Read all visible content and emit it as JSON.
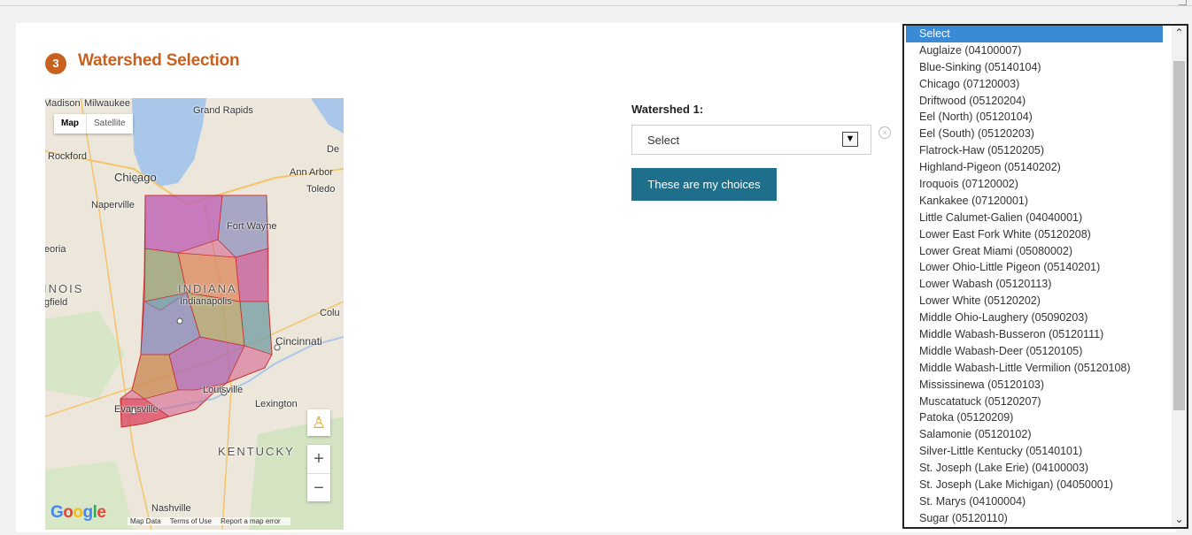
{
  "heading": {
    "step": "3",
    "title": "Watershed Selection"
  },
  "map": {
    "type_control": {
      "map": "Map",
      "satellite": "Satellite"
    },
    "labels": {
      "madison": "Madison",
      "milwaukee": "Milwaukee",
      "grand_rapids": "Grand Rapids",
      "rockford": "Rockford",
      "chicago": "Chicago",
      "ann_arbor": "Ann Arbor",
      "toledo": "Toledo",
      "naperville": "Naperville",
      "fort_wayne": "Fort Wayne",
      "peoria": "eoria",
      "illinois": "INOIS",
      "springfield": "gfield",
      "indiana": "INDIANA",
      "indianapolis": "Indianapolis",
      "columbus": "Colu",
      "cincinnati": "Cincinnati",
      "louisville": "Louisville",
      "evansville": "Evansville",
      "lexington": "Lexington",
      "kentucky": "KENTUCKY",
      "nashville": "Nashville",
      "detroit": "De"
    },
    "google": "Google",
    "footer": {
      "map_data": "Map Data",
      "terms": "Terms of Use",
      "report": "Report a map error"
    }
  },
  "watershed": {
    "label": "Watershed 1:",
    "selected": "Select",
    "clear_symbol": "×",
    "submit": "These are my choices"
  },
  "dropdown_options": [
    "Select",
    "Auglaize (04100007)",
    "Blue-Sinking (05140104)",
    "Chicago (07120003)",
    "Driftwood (05120204)",
    "Eel (North) (05120104)",
    "Eel (South) (05120203)",
    "Flatrock-Haw (05120205)",
    "Highland-Pigeon (05140202)",
    "Iroquois (07120002)",
    "Kankakee (07120001)",
    "Little Calumet-Galien (04040001)",
    "Lower East Fork White (05120208)",
    "Lower Great Miami (05080002)",
    "Lower Ohio-Little Pigeon (05140201)",
    "Lower Wabash (05120113)",
    "Lower White (05120202)",
    "Middle Ohio-Laughery (05090203)",
    "Middle Wabash-Busseron (05120111)",
    "Middle Wabash-Deer (05120105)",
    "Middle Wabash-Little Vermilion (05120108)",
    "Mississinewa (05120103)",
    "Muscatatuck (05120207)",
    "Patoka (05120209)",
    "Salamonie (05120102)",
    "Silver-Little Kentucky (05140101)",
    "St. Joseph (Lake Erie) (04100003)",
    "St. Joseph (Lake Michigan) (04050001)",
    "St. Marys (04100004)",
    "Sugar (05120110)"
  ],
  "colors": {
    "accent": "#c8601f",
    "button": "#1d6f8b",
    "selected_option": "#3a8ad6"
  }
}
